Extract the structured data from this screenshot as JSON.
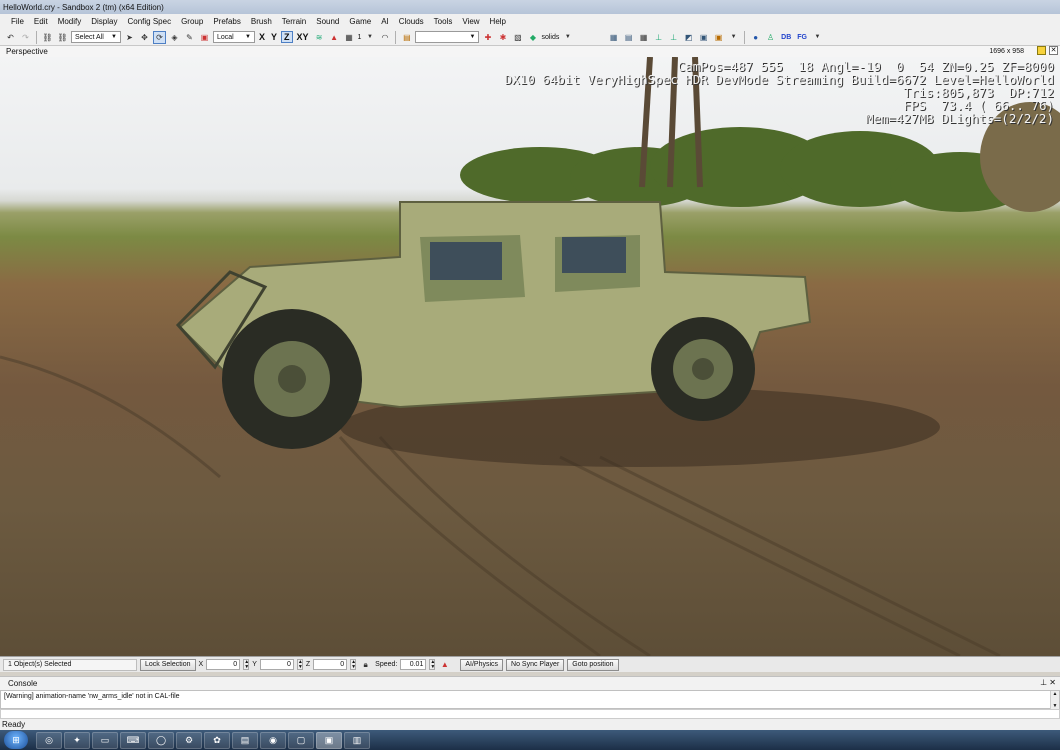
{
  "window": {
    "title": "HelloWorld.cry - Sandbox 2 (tm) (x64 Edition)"
  },
  "menu": [
    "File",
    "Edit",
    "Modify",
    "Display",
    "Config Spec",
    "Group",
    "Prefabs",
    "Brush",
    "Terrain",
    "Sound",
    "Game",
    "AI",
    "Clouds",
    "Tools",
    "View",
    "Help"
  ],
  "toolbar": {
    "select_all": "Select All",
    "coord_system": "Local",
    "axes": [
      "X",
      "Y",
      "Z",
      "XY"
    ],
    "selected_axis": "Z",
    "grid_value": "1",
    "render_mode": "solids",
    "brush_icons": [
      "layer-icon",
      "terrain-icon",
      "grid-icon",
      "snap-icon",
      "pin-icon",
      "cube-icon",
      "camera-icon"
    ],
    "right_labels": [
      "DB",
      "FG"
    ]
  },
  "viewport": {
    "name": "Perspective",
    "resolution": "1696 x 958",
    "hud": [
      "CamPos=487 555  18 Angl=-19  0  54 ZN=0.25 ZF=8000",
      "DX10 64bit VeryHighSpec HDR DevMode Streaming Build=6672 Level=HelloWorld",
      "Tris:805,873  DP:712",
      "FPS  73.4 ( 66.. 76)",
      "Mem=427MB DLights=(2/2/2)"
    ]
  },
  "coords": {
    "selection": "1 Object(s) Selected",
    "lock_label": "Lock Selection",
    "x_label": "X",
    "x": "0",
    "y_label": "Y",
    "y": "0",
    "z_label": "Z",
    "z": "0",
    "speed_label": "Speed:",
    "speed": "0.01",
    "ai_physics": "AI/Physics",
    "no_sync": "No Sync Player",
    "goto": "Goto position"
  },
  "console": {
    "title": "Console",
    "message": "[Warning] animation-name 'nw_arms_idle' not in CAL-file"
  },
  "status": "Ready",
  "taskbar": {
    "items": [
      "chrome-icon",
      "app-icon",
      "folder-icon",
      "keyboard-icon",
      "obs-icon",
      "steam-icon",
      "app2-icon",
      "notepad-icon",
      "media-icon",
      "window-icon",
      "sandbox-icon",
      "explorer-icon"
    ]
  }
}
